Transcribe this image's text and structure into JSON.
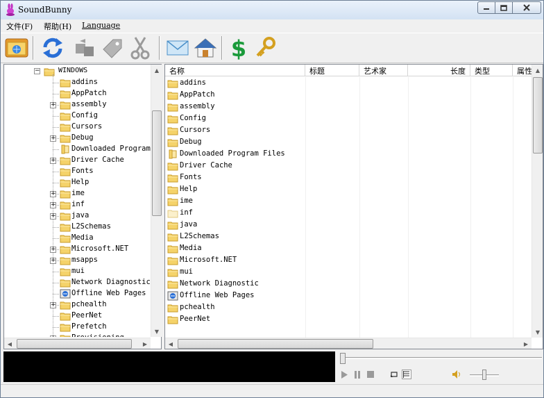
{
  "window": {
    "title": "SoundBunny"
  },
  "menu": {
    "file": "文件(F)",
    "help": "帮助(H)",
    "language": "Language"
  },
  "toolbar": {
    "buttons": [
      {
        "icon": "open-folder-icon"
      },
      {
        "icon": "refresh-arrows-icon"
      },
      {
        "icon": "convert-disabled-icon"
      },
      {
        "icon": "tag-disabled-icon"
      },
      {
        "icon": "cut-disabled-icon"
      },
      {
        "icon": "mail-icon"
      },
      {
        "icon": "home-icon"
      },
      {
        "icon": "dollar-icon"
      },
      {
        "icon": "key-icon"
      }
    ]
  },
  "tree": {
    "root": "WINDOWS",
    "items": [
      {
        "label": "addins",
        "expandable": false
      },
      {
        "label": "AppPatch",
        "expandable": false
      },
      {
        "label": "assembly",
        "expandable": true
      },
      {
        "label": "Config",
        "expandable": false
      },
      {
        "label": "Cursors",
        "expandable": false
      },
      {
        "label": "Debug",
        "expandable": true
      },
      {
        "label": "Downloaded Program",
        "expandable": false,
        "special": true
      },
      {
        "label": "Driver Cache",
        "expandable": true
      },
      {
        "label": "Fonts",
        "expandable": false
      },
      {
        "label": "Help",
        "expandable": false
      },
      {
        "label": "ime",
        "expandable": true
      },
      {
        "label": "inf",
        "expandable": true
      },
      {
        "label": "java",
        "expandable": true
      },
      {
        "label": "L2Schemas",
        "expandable": false
      },
      {
        "label": "Media",
        "expandable": false
      },
      {
        "label": "Microsoft.NET",
        "expandable": true
      },
      {
        "label": "msapps",
        "expandable": true
      },
      {
        "label": "mui",
        "expandable": false
      },
      {
        "label": "Network Diagnostic",
        "expandable": false
      },
      {
        "label": "Offline Web Pages",
        "expandable": false,
        "web": true
      },
      {
        "label": "pchealth",
        "expandable": true
      },
      {
        "label": "PeerNet",
        "expandable": false
      },
      {
        "label": "Prefetch",
        "expandable": false
      },
      {
        "label": "Provisioning",
        "expandable": true
      }
    ]
  },
  "list": {
    "columns": [
      "名称",
      "标题",
      "艺术家",
      "长度",
      "类型",
      "属性"
    ],
    "rows": [
      {
        "name": "addins"
      },
      {
        "name": "AppPatch"
      },
      {
        "name": "assembly"
      },
      {
        "name": "Config"
      },
      {
        "name": "Cursors"
      },
      {
        "name": "Debug"
      },
      {
        "name": "Downloaded Program Files",
        "special": true
      },
      {
        "name": "Driver Cache"
      },
      {
        "name": "Fonts"
      },
      {
        "name": "Help"
      },
      {
        "name": "ime"
      },
      {
        "name": "inf",
        "faded": true
      },
      {
        "name": "java"
      },
      {
        "name": "L2Schemas"
      },
      {
        "name": "Media"
      },
      {
        "name": "Microsoft.NET"
      },
      {
        "name": "mui"
      },
      {
        "name": "Network Diagnostic"
      },
      {
        "name": "Offline Web Pages",
        "web": true
      },
      {
        "name": "pchealth"
      },
      {
        "name": "PeerNet"
      }
    ]
  },
  "player": {
    "seek_position": 0.0,
    "volume": 0.5
  },
  "colors": {
    "folder": "#f5d36a",
    "folder_edge": "#c89b2a",
    "accent_green": "#1a9a3a",
    "accent_blue": "#2a6fd6"
  }
}
